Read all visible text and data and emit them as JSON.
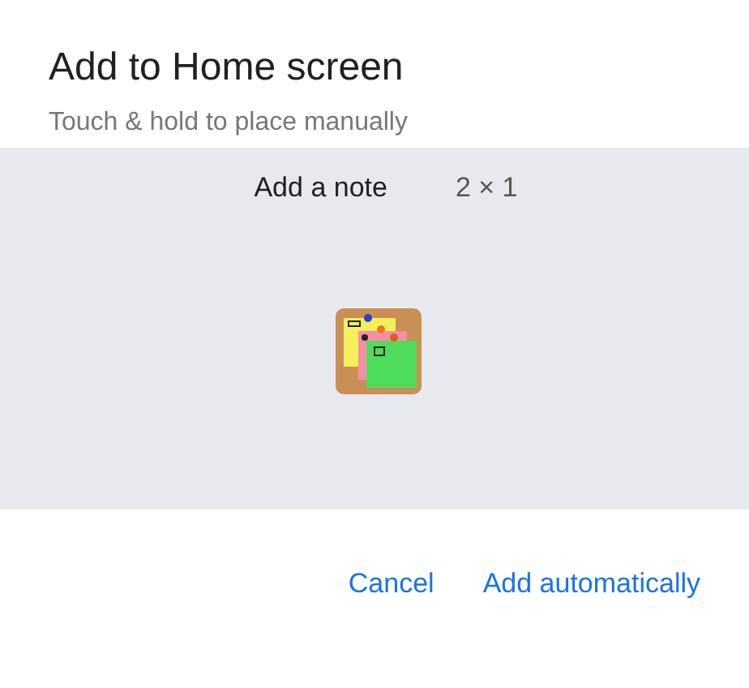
{
  "dialog": {
    "title": "Add to Home screen",
    "subtitle": "Touch & hold to place manually"
  },
  "widget": {
    "name": "Add a note",
    "size": "2 × 1"
  },
  "buttons": [
    "Cancel",
    "Add automatically"
  ]
}
